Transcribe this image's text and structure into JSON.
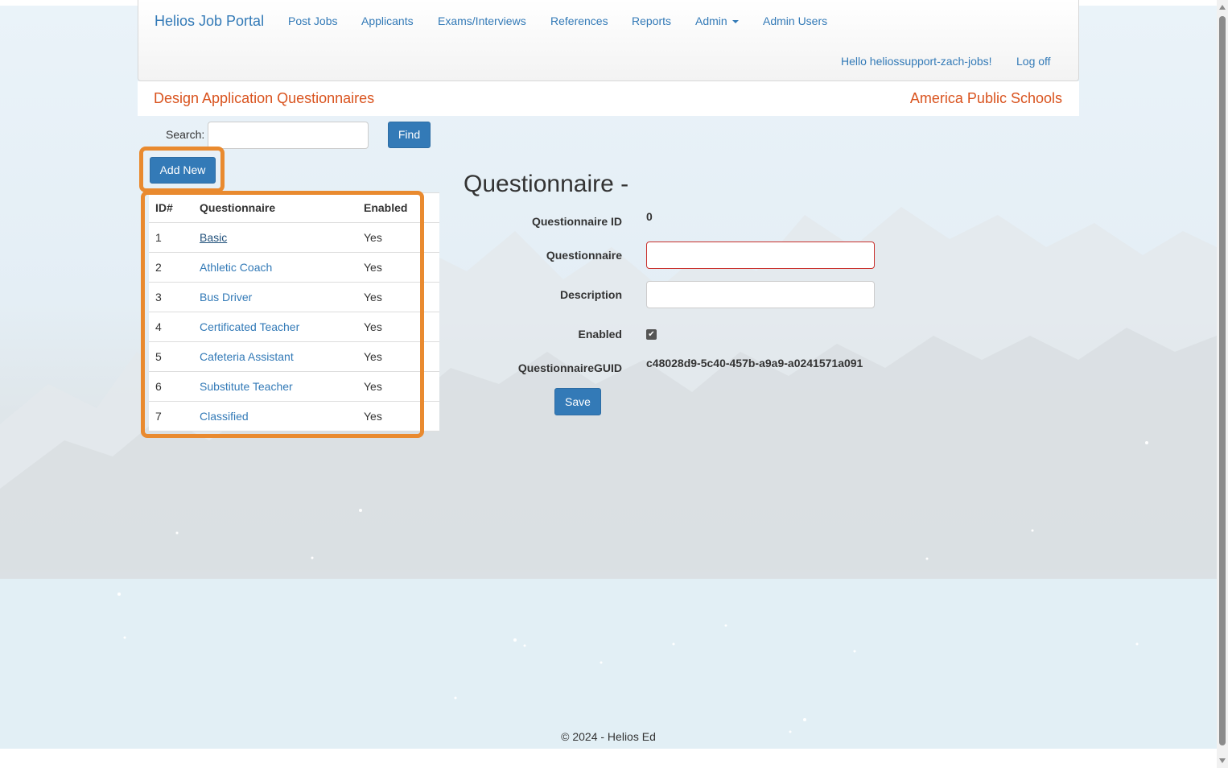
{
  "navbar": {
    "brand": "Helios Job Portal",
    "items": [
      "Post Jobs",
      "Applicants",
      "Exams/Interviews",
      "References",
      "Reports",
      "Admin",
      "Admin Users"
    ],
    "greeting": "Hello heliossupport-zach-jobs!",
    "logoff": "Log off"
  },
  "subheader": {
    "title": "Design Application Questionnaires",
    "org": "America Public Schools"
  },
  "search": {
    "label": "Search:",
    "value": "",
    "find_label": "Find"
  },
  "add_new_label": "Add New",
  "table": {
    "headers": [
      "ID#",
      "Questionnaire",
      "Enabled"
    ],
    "rows": [
      {
        "id": "1",
        "name": "Basic",
        "enabled": "Yes"
      },
      {
        "id": "2",
        "name": "Athletic Coach",
        "enabled": "Yes"
      },
      {
        "id": "3",
        "name": "Bus Driver",
        "enabled": "Yes"
      },
      {
        "id": "4",
        "name": "Certificated Teacher",
        "enabled": "Yes"
      },
      {
        "id": "5",
        "name": "Cafeteria Assistant",
        "enabled": "Yes"
      },
      {
        "id": "6",
        "name": "Substitute Teacher",
        "enabled": "Yes"
      },
      {
        "id": "7",
        "name": "Classified",
        "enabled": "Yes"
      }
    ]
  },
  "form": {
    "title": "Questionnaire -",
    "id_label": "Questionnaire ID",
    "id_value": "0",
    "name_label": "Questionnaire",
    "name_value": "",
    "description_label": "Description",
    "description_value": "",
    "enabled_label": "Enabled",
    "enabled": true,
    "guid_label": "QuestionnaireGUID",
    "guid_value": "c48028d9-5c40-457b-a9a9-a0241571a091",
    "save_label": "Save"
  },
  "footer": "© 2024 - Helios Ed",
  "colors": {
    "link": "#337ab7",
    "accent_orange": "#d9531e",
    "highlight": "#e98a2f",
    "button": "#337ab7"
  }
}
